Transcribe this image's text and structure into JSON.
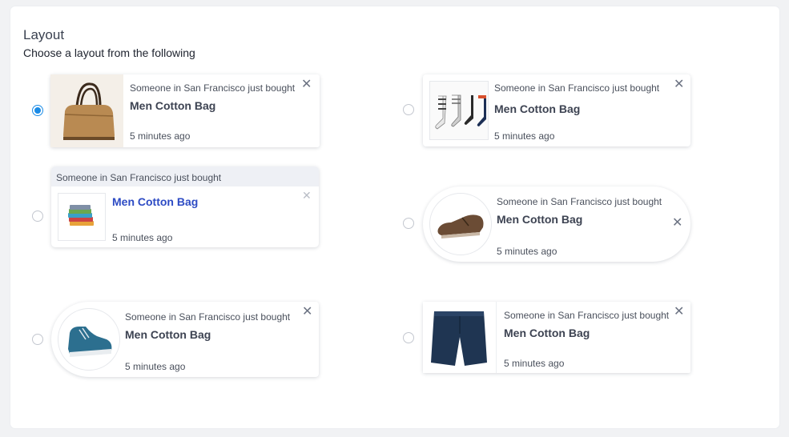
{
  "heading": "Layout",
  "subheading": "Choose a layout from the following",
  "selected_layout": 1,
  "accent_color": "#1a8be6",
  "highlight_color": "#2d4bc4",
  "close_symbol": "✕",
  "layouts": [
    {
      "message": "Someone in San Francisco just bought",
      "product": "Men Cotton Bag",
      "time": "5 minutes ago",
      "image": "handbag-image"
    },
    {
      "message": "Someone in San Francisco just bought",
      "product": "Men Cotton Bag",
      "time": "5 minutes ago",
      "image": "socks-image"
    },
    {
      "message": "Someone in San Francisco just bought",
      "product": "Men Cotton Bag",
      "time": "5 minutes ago",
      "image": "folded-shirts-image"
    },
    {
      "message": "Someone in San Francisco just bought",
      "product": "Men Cotton Bag",
      "time": "5 minutes ago",
      "image": "leather-shoe-image"
    },
    {
      "message": "Someone in San Francisco just bought",
      "product": "Men Cotton Bag",
      "time": "5 minutes ago",
      "image": "sneaker-image"
    },
    {
      "message": "Someone in San Francisco just bought",
      "product": "Men Cotton Bag",
      "time": "5 minutes ago",
      "image": "shorts-image"
    }
  ]
}
